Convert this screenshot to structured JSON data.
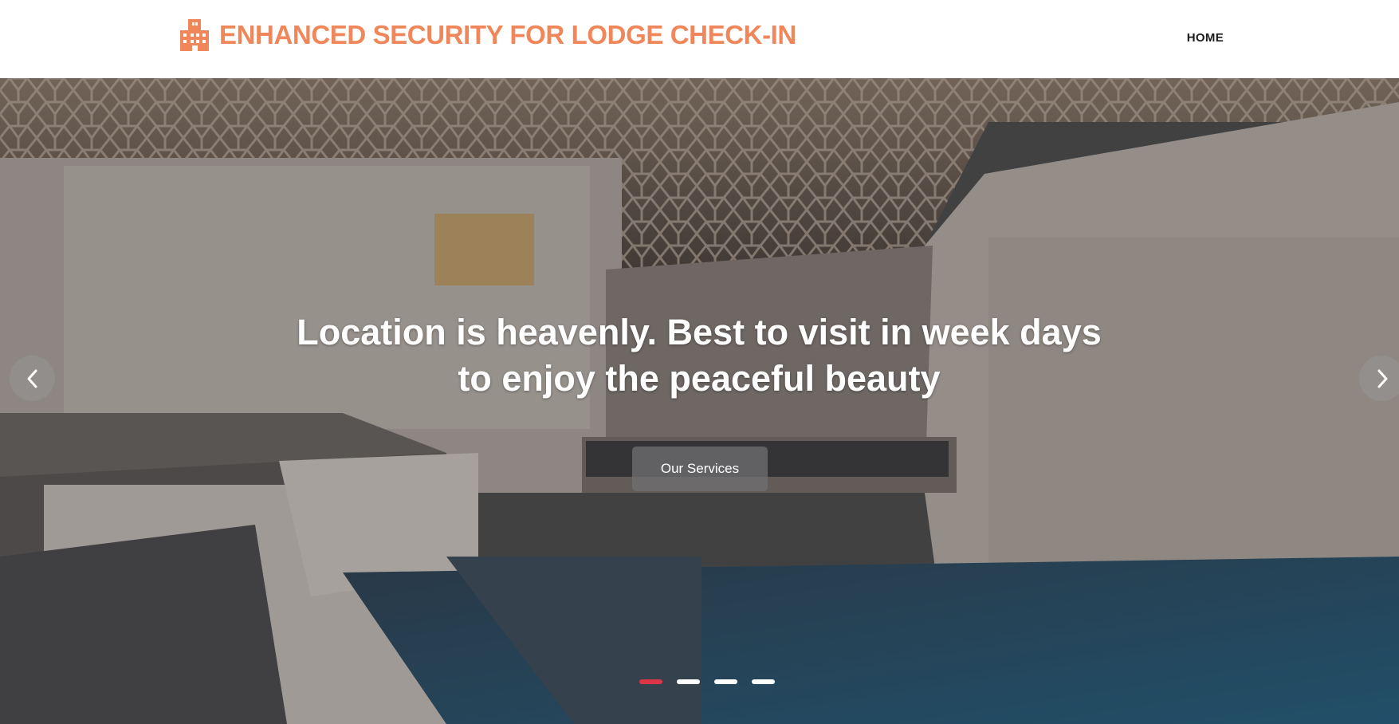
{
  "header": {
    "brand_title": "ENHANCED SECURITY FOR LODGE CHECK-IN",
    "brand_icon": "building-icon",
    "nav": [
      {
        "label": "HOME"
      }
    ]
  },
  "hero": {
    "headline_line1": "Location is heavenly. Best to visit in week days",
    "headline_line2": "to enjoy the peaceful beauty",
    "cta_label": "Our Services",
    "prev_icon": "chevron-left-icon",
    "next_icon": "chevron-right-icon",
    "slide_count": 4,
    "active_slide": 1
  },
  "colors": {
    "brand": "#f0875a",
    "nav_text": "#1b1b1b",
    "indicator_active": "#dc3545",
    "indicator_inactive": "#ffffff"
  }
}
